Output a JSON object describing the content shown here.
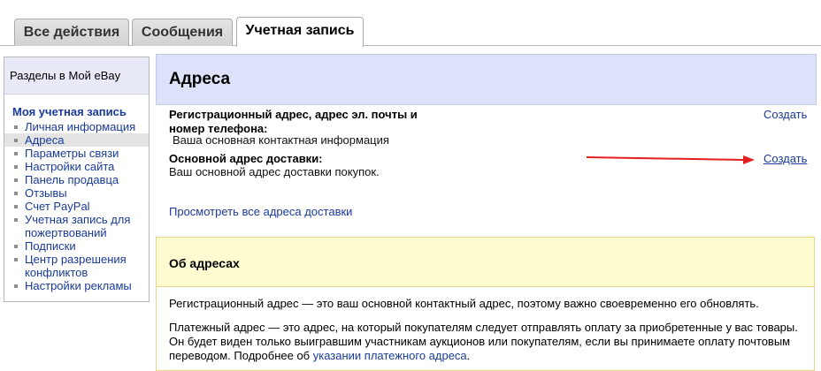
{
  "tabs": [
    {
      "label": "Все действия"
    },
    {
      "label": "Сообщения"
    },
    {
      "label": "Учетная запись"
    }
  ],
  "sidebar": {
    "title": "Разделы в Мой eBay",
    "section": "Моя учетная запись",
    "items": [
      {
        "label": "Личная информация"
      },
      {
        "label": "Адреса"
      },
      {
        "label": "Параметры связи"
      },
      {
        "label": "Настройки сайта"
      },
      {
        "label": "Панель продавца"
      },
      {
        "label": "Отзывы"
      },
      {
        "label": "Счет PayPal"
      },
      {
        "label": "Учетная запись для пожертвований"
      },
      {
        "label": "Подписки"
      },
      {
        "label": "Центр разрешения конфликтов"
      },
      {
        "label": "Настройки рекламы"
      }
    ]
  },
  "main": {
    "title": "Адреса",
    "registration": {
      "title": "Регистрационный адрес, адрес эл. почты и номер телефона:",
      "desc": "Ваша основная контактная информация",
      "action": "Создать"
    },
    "shipping": {
      "title": "Основной адрес доставки:",
      "desc": "Ваш основной адрес доставки покупок.",
      "action": "Создать"
    },
    "view_all": "Просмотреть все адреса доставки"
  },
  "about": {
    "title": "Об адресах",
    "p1": "Регистрационный адрес — это ваш основной контактный адрес, поэтому важно своевременно его обновлять.",
    "p2_line1": "Платежный адрес — это адрес, на который покупателям следует отправлять оплату за приобретенные у вас товары.",
    "p2_line2": "Он будет виден только выигравшим участникам аукционов или покупателям, если вы принимаете оплату почтовым",
    "p2_line3_prefix": "переводом. Подробнее об ",
    "p2_link": "указании платежного адреса",
    "p2_suffix": "."
  },
  "colors": {
    "link": "#1a3b9a",
    "arrow": "#e31f1f",
    "header_bg": "#dde2fa",
    "info_bg": "#fdfbd0"
  }
}
